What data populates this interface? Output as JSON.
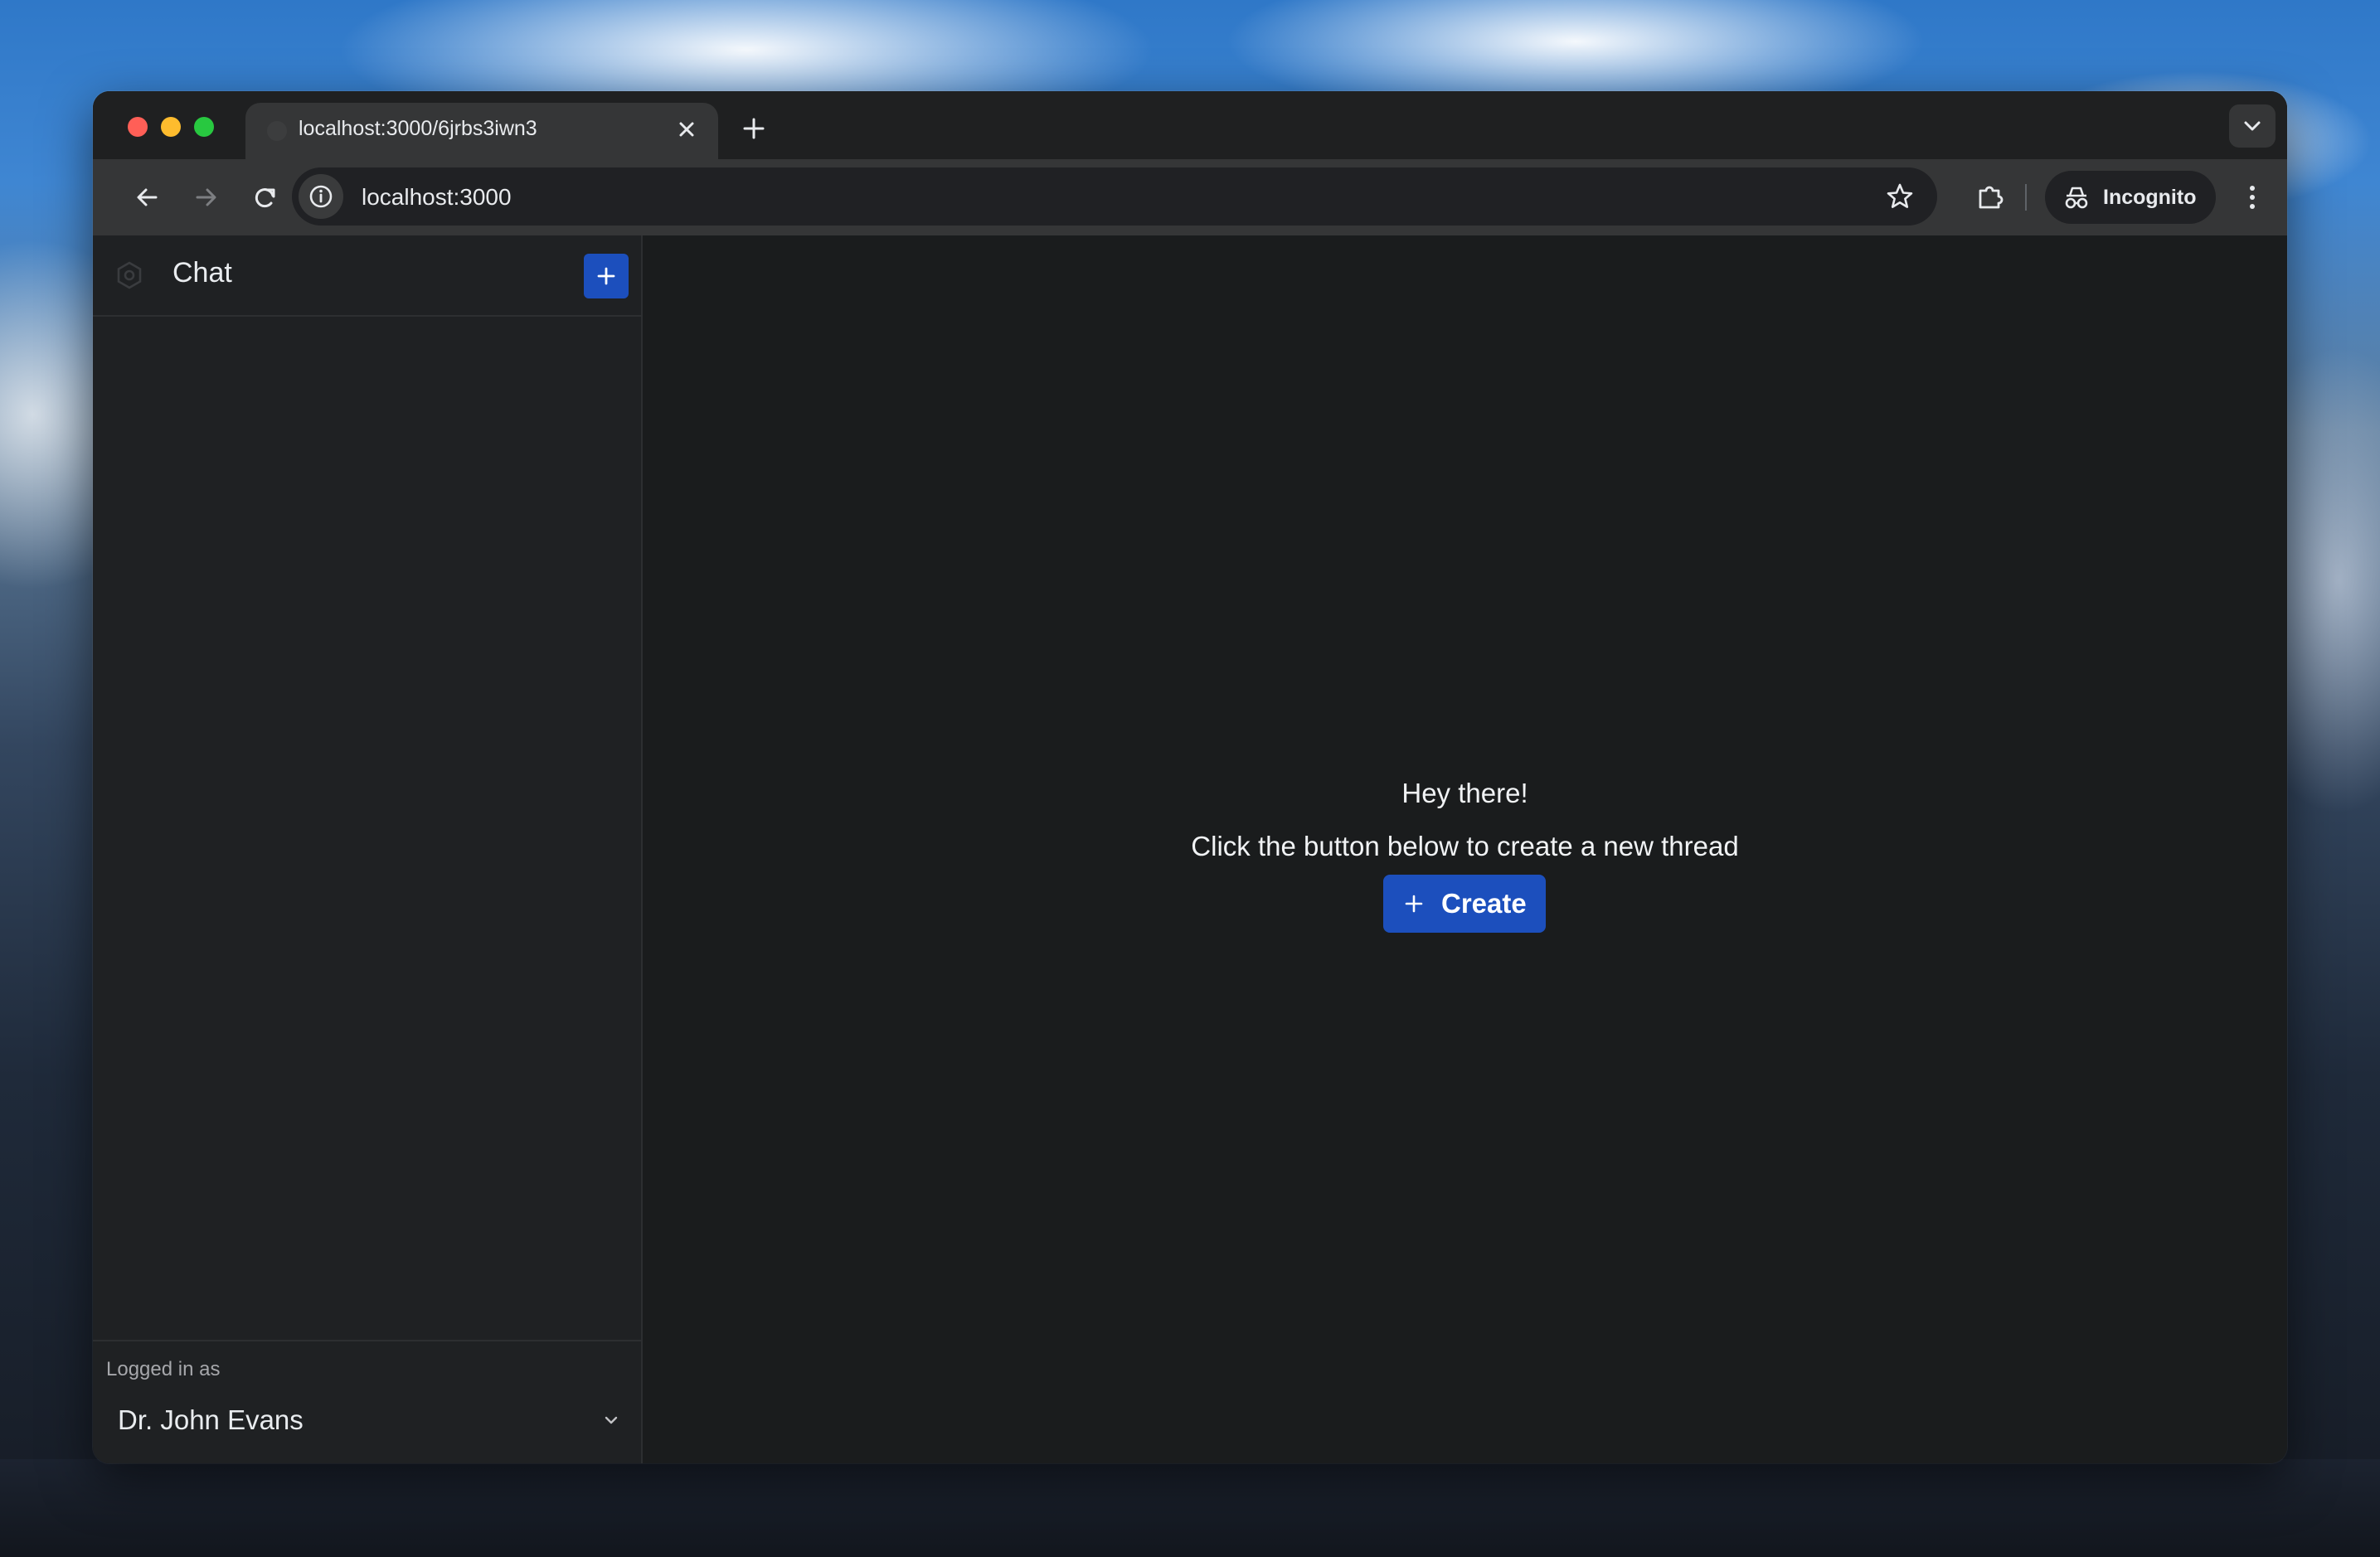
{
  "browser": {
    "tab": {
      "title": "localhost:3000/6jrbs3iwn3",
      "close_icon": "close-icon"
    },
    "new_tab_icon": "plus-icon",
    "tab_menu_icon": "chevron-down-icon",
    "address_bar": {
      "url": "localhost:3000",
      "site_info_icon": "info-icon",
      "bookmark_icon": "star-icon"
    },
    "extensions_icon": "puzzle-icon",
    "profile": {
      "label": "Incognito",
      "icon": "incognito-icon"
    },
    "menu_icon": "kebab-icon"
  },
  "sidebar": {
    "title": "Chat",
    "logo_icon": "hexagon-logo-icon",
    "add_button_icon": "plus-icon",
    "footer": {
      "logged_in_label": "Logged in as",
      "user_name": "Dr. John Evans"
    }
  },
  "main": {
    "empty_state": {
      "greeting": "Hey there!",
      "message": "Click the button below to create a new thread",
      "create_button": {
        "label": "Create",
        "icon": "plus-icon"
      }
    }
  },
  "colors": {
    "accent": "#1c4fbd",
    "app_background": "#1a1c1d",
    "sidebar_background": "#1f2123",
    "browser_chrome": "#353637"
  }
}
